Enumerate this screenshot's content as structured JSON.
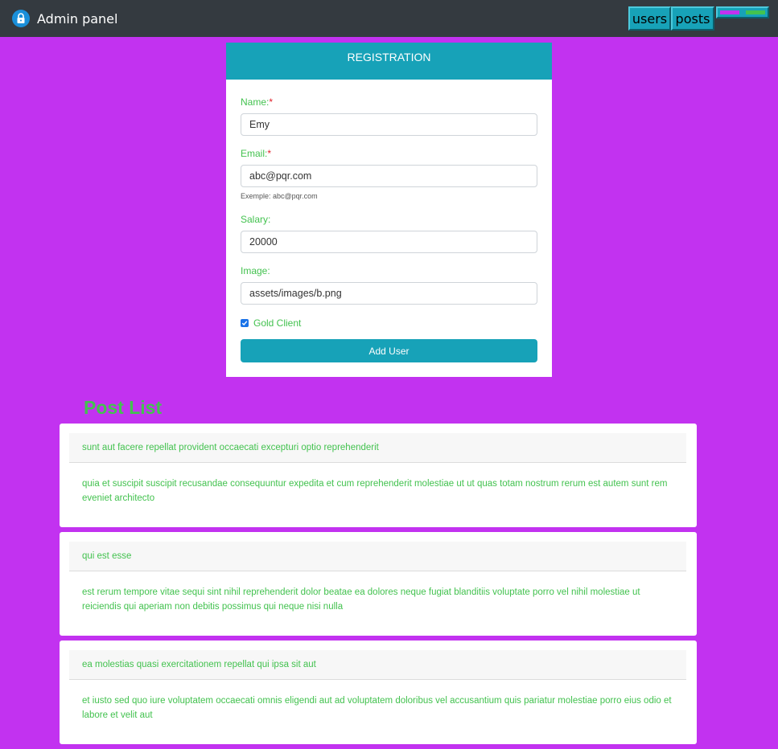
{
  "app": {
    "title": "Admin panel",
    "brand_icon": "lock-icon"
  },
  "nav": {
    "users_label": "users",
    "posts_label": "posts",
    "theme_colors": [
      "#c232f0",
      "#43c24f"
    ]
  },
  "registration": {
    "title": "REGISTRATION",
    "name": {
      "label": "Name:",
      "required_mark": "*",
      "value": "Emy"
    },
    "email": {
      "label": "Email:",
      "required_mark": "*",
      "value": "abc@pqr.com",
      "help": "Exemple: abc@pqr.com"
    },
    "salary": {
      "label": "Salary:",
      "value": "20000"
    },
    "image": {
      "label": "Image:",
      "value": "assets/images/b.png"
    },
    "gold_client": {
      "label": "Gold Client",
      "checked": true
    },
    "submit_label": "Add User"
  },
  "posts": {
    "title": "Post List",
    "items": [
      {
        "title": "sunt aut facere repellat provident occaecati excepturi optio reprehenderit",
        "body": "quia et suscipit suscipit recusandae consequuntur expedita et cum reprehenderit molestiae ut ut quas totam nostrum rerum est autem sunt rem eveniet architecto"
      },
      {
        "title": "qui est esse",
        "body": "est rerum tempore vitae sequi sint nihil reprehenderit dolor beatae ea dolores neque fugiat blanditiis voluptate porro vel nihil molestiae ut reiciendis qui aperiam non debitis possimus qui neque nisi nulla"
      },
      {
        "title": "ea molestias quasi exercitationem repellat qui ipsa sit aut",
        "body": "et iusto sed quo iure voluptatem occaecati omnis eligendi aut ad voluptatem doloribus vel accusantium quis pariatur molestiae porro eius odio et labore et velit aut"
      }
    ]
  },
  "colors": {
    "background": "#c232f0",
    "navbar": "#343a40",
    "accent": "#17a2b8",
    "text_green": "#43c24f"
  }
}
